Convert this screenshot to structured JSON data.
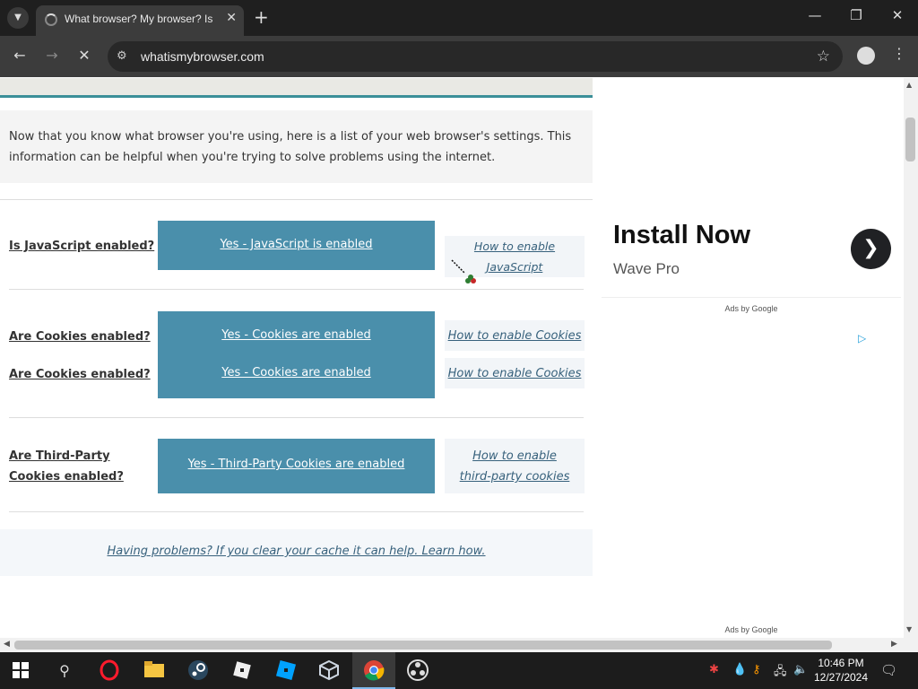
{
  "browser": {
    "tab_title": "What browser? My browser? Is",
    "url": "whatismybrowser.com",
    "icons": {
      "tab_search": "chevron-down-icon",
      "new_tab": "+",
      "minimize": "—",
      "restore": "❐",
      "close": "✕",
      "back": "←",
      "forward": "→",
      "stop": "✕",
      "site_settings": "⚙",
      "bookmark": "☆",
      "menu": "⋮"
    }
  },
  "page": {
    "intro": "Now that you know what browser you're using, here is a list of your web browser's settings. This information can be helpful when you're trying to solve problems using the internet.",
    "rows": [
      {
        "question": "Is JavaScript enabled?",
        "answer": "Yes - JavaScript is enabled",
        "howto": "How to enable JavaScript"
      },
      {
        "question": "Are Cookies enabled?",
        "answer": "Yes - Cookies are enabled",
        "howto": "How to enable Cookies"
      },
      {
        "question": "Are Cookies enabled?",
        "answer": "Yes - Cookies are enabled",
        "howto": "How to enable Cookies"
      },
      {
        "question": "Are Third-Party Cookies enabled?",
        "answer": "Yes - Third-Party Cookies are enabled",
        "howto": "How to enable third-party cookies"
      }
    ],
    "problems_link": "Having problems? If you clear your cache it can help. Learn how.",
    "accent_color": "#4a8fab"
  },
  "ad": {
    "title": "Install Now",
    "subtitle": "Wave Pro",
    "ads_by": "Ads by Google",
    "ads_by_2": "Ads by Google"
  },
  "taskbar": {
    "time": "10:46 PM",
    "date": "12/27/2024",
    "apps": [
      "windows-start",
      "search",
      "opera",
      "file-explorer",
      "steam",
      "roblox",
      "roblox-studio",
      "virtualbox",
      "chrome",
      "obs"
    ]
  }
}
